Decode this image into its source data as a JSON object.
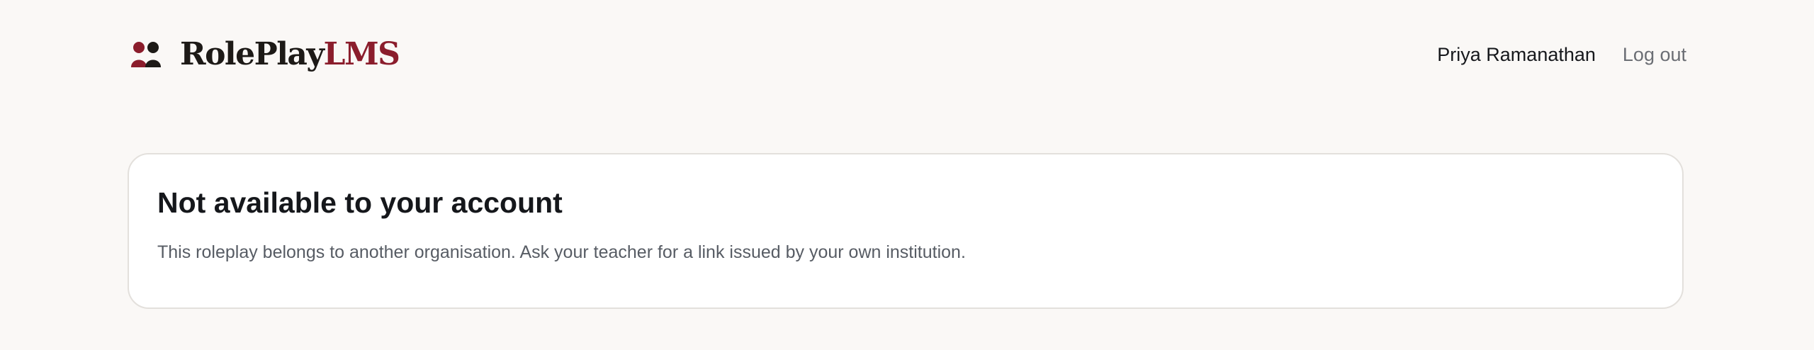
{
  "header": {
    "brand": {
      "name_primary": "RolePlay",
      "name_accent": "LMS",
      "icon": "two-people-icon",
      "colors": {
        "dark": "#1d1a17",
        "accent": "#8b1d2c"
      }
    },
    "user": {
      "name": "Priya Ramanathan",
      "logout_label": "Log out"
    }
  },
  "message": {
    "title": "Not available to your account",
    "body": "This roleplay belongs to another organisation. Ask your teacher for a link issued by your own institution."
  }
}
